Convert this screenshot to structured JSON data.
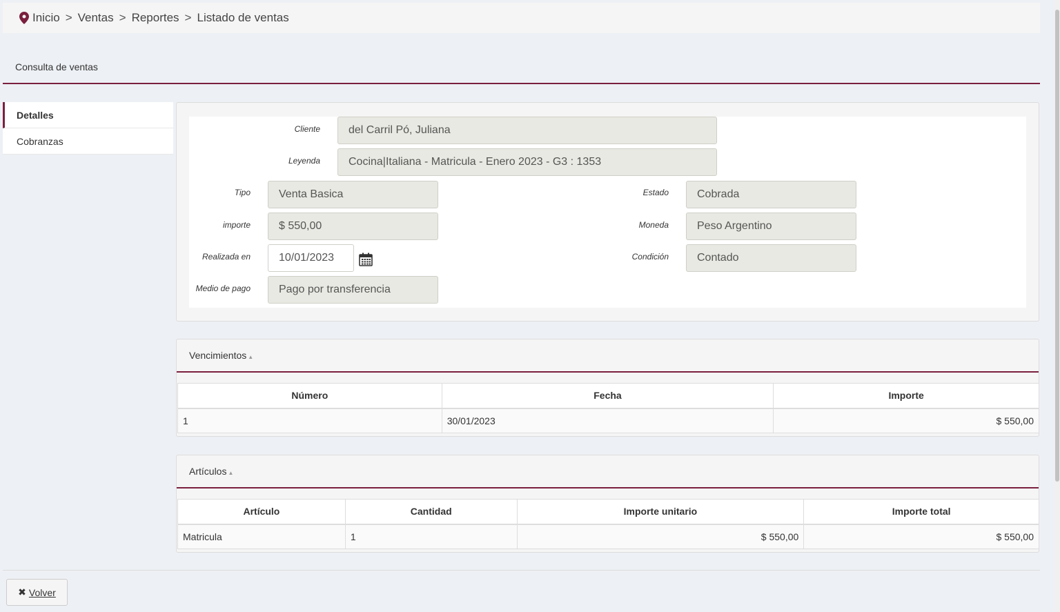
{
  "breadcrumb": {
    "items": [
      "Inicio",
      "Ventas",
      "Reportes",
      "Listado de ventas"
    ],
    "separator": ">"
  },
  "page_title": "Consulta de ventas",
  "side_tabs": [
    {
      "label": "Detalles",
      "active": true
    },
    {
      "label": "Cobranzas",
      "active": false
    }
  ],
  "form": {
    "cliente": {
      "label": "Cliente",
      "value": "del Carril Pó, Juliana"
    },
    "leyenda": {
      "label": "Leyenda",
      "value": "Cocina|Italiana - Matricula - Enero 2023 - G3 : 1353"
    },
    "tipo": {
      "label": "Tipo",
      "value": "Venta Basica"
    },
    "estado": {
      "label": "Estado",
      "value": "Cobrada"
    },
    "importe": {
      "label": "importe",
      "value": "$ 550,00"
    },
    "moneda": {
      "label": "Moneda",
      "value": "Peso Argentino"
    },
    "realizada": {
      "label": "Realizada en",
      "value": "10/01/2023"
    },
    "condicion": {
      "label": "Condición",
      "value": "Contado"
    },
    "medio": {
      "label": "Medio de pago",
      "value": "Pago por transferencia"
    }
  },
  "vencimientos": {
    "title": "Vencimientos",
    "headers": [
      "Número",
      "Fecha",
      "Importe"
    ],
    "rows": [
      [
        "1",
        "30/01/2023",
        "$ 550,00"
      ]
    ]
  },
  "articulos": {
    "title": "Artículos",
    "headers": [
      "Artículo",
      "Cantidad",
      "Importe unitario",
      "Importe total"
    ],
    "rows": [
      [
        "Matricula",
        "1",
        "$ 550,00",
        "$ 550,00"
      ]
    ]
  },
  "back_button": {
    "label": "Volver"
  },
  "colors": {
    "accent": "#7a1f3d",
    "background": "#edf0f4",
    "field_readonly": "#e9e9e3"
  }
}
